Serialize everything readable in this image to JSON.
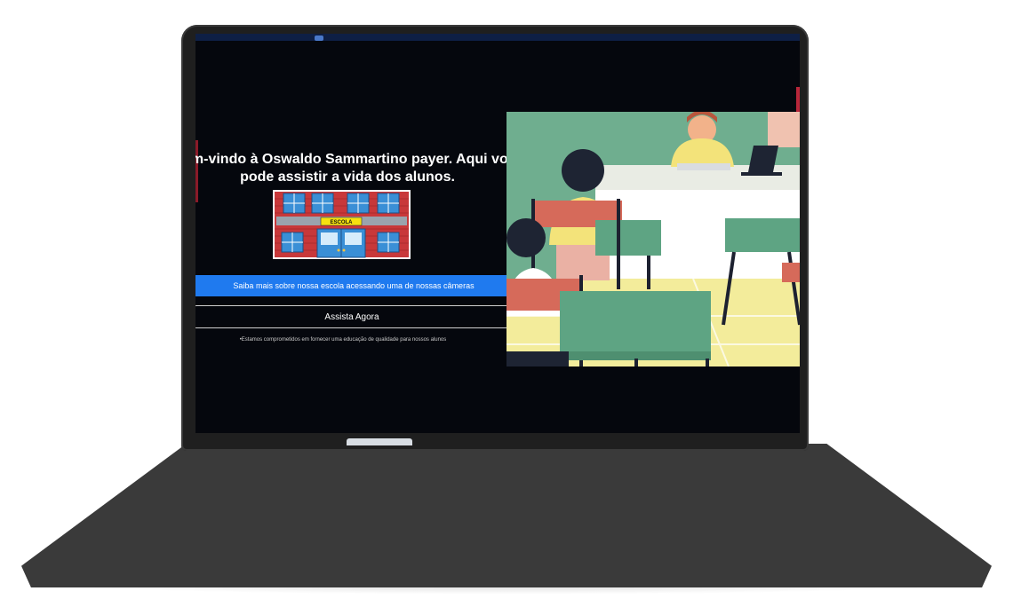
{
  "hero": {
    "welcome_line1": "em-vindo à Oswaldo Sammartino payer. Aqui você",
    "welcome_line2": "pode assistir a vida dos alunos.",
    "school_sign": "ESCOLA"
  },
  "buttons": {
    "cameras_label": "Saiba mais sobre nossa escola acessando uma de nossas câmeras",
    "watch_label": "Assista Agora"
  },
  "footer_note": "•Estamos comprometidos em fornecer uma educação de qualidade para nossos alunos",
  "colors": {
    "screen_bg": "#05070d",
    "primary_button": "#1f7aef",
    "laptop_body": "#3a3a3a"
  }
}
